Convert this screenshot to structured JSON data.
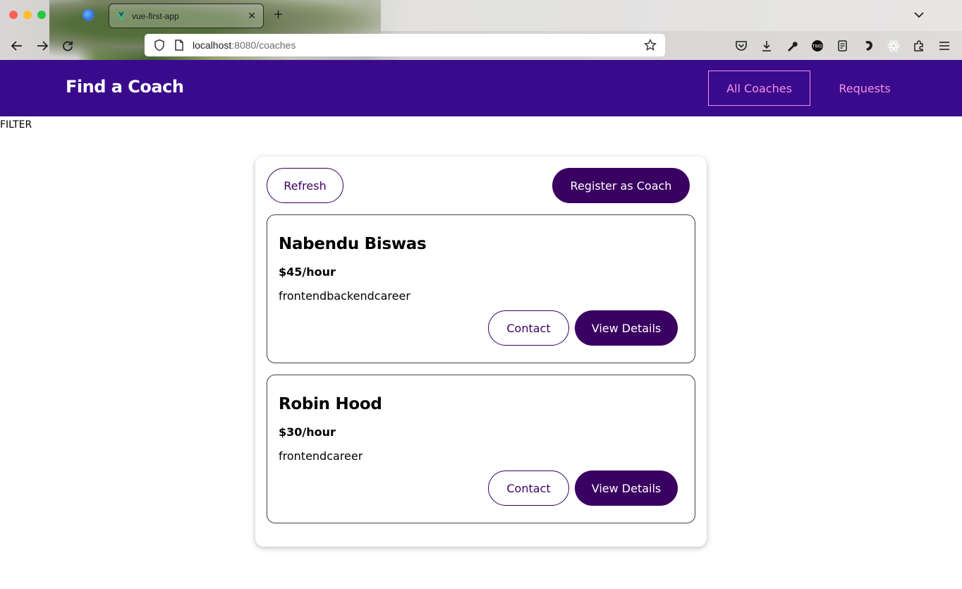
{
  "browser": {
    "tab_title": "vue-first-app",
    "url_host": "localhost",
    "url_path": ":8080/coaches",
    "new_tab": "+",
    "close": "✕"
  },
  "header": {
    "brand": "Find a Coach",
    "nav": [
      {
        "label": "All Coaches",
        "active": true
      },
      {
        "label": "Requests",
        "active": false
      }
    ]
  },
  "filter": {
    "label": "FILTER"
  },
  "controls": {
    "refresh_label": "Refresh",
    "register_label": "Register as Coach"
  },
  "coaches": [
    {
      "name": "Nabendu Biswas",
      "rate": "$45/hour",
      "areas": "frontendbackendcareer",
      "contact_label": "Contact",
      "details_label": "View Details"
    },
    {
      "name": "Robin Hood",
      "rate": "$30/hour",
      "areas": "frontendcareer",
      "contact_label": "Contact",
      "details_label": "View Details"
    }
  ],
  "colors": {
    "header_bg": "#3a0a8c",
    "nav_text": "#f391e3",
    "primary": "#3a0061"
  }
}
